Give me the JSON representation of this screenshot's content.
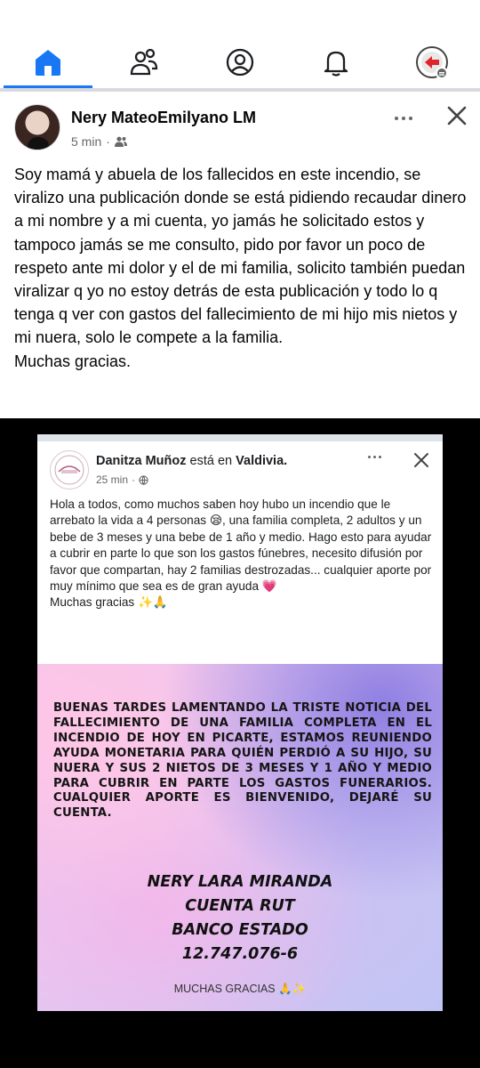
{
  "nav": {
    "items": [
      "home",
      "friends",
      "profile",
      "notifications",
      "menu"
    ],
    "active": "home",
    "accent_color": "#1877f2"
  },
  "post": {
    "author": "Nery MateoEmilyano LM",
    "time": "5 min",
    "audience_icon": "friends-icon",
    "text": "Soy mamá y abuela de los fallecidos en este incendio, se viralizo una publicación donde se está pidiendo recaudar dinero a mi nombre y a mi cuenta, yo jamás he solicitado estos y tampoco jamás se me consulto, pido por favor un poco de respeto  ante mi dolor y el de mi familia, solicito también puedan viralizar q yo no estoy detrás de esta publicación y todo lo q tenga q ver con gastos del fallecimiento de mi hijo mis nietos y mi nuera, solo le compete a la familia.\nMuchas gracias."
  },
  "shared": {
    "author": "Danitza Muñoz",
    "connector": "está en",
    "location": "Valdivia.",
    "time": "25 min",
    "audience_icon": "globe-icon",
    "text": "Hola a todos, como muchos saben hoy hubo un incendio que le arrebato la vida a 4 personas 😪, una familia completa, 2 adultos y un bebe de 3 meses y una bebe de 1 año y medio.  Hago esto para ayudar a cubrir en parte lo que son los gastos fúnebres, necesito difusión por favor que compartan, hay 2 familias destrozadas... cualquier aporte por muy mínimo que sea es de gran ayuda 💗\nMuchas gracias ✨🙏",
    "flyer": {
      "message": "BUENAS TARDES LAMENTANDO LA TRISTE NOTICIA DEL FALLECIMIENTO DE UNA FAMILIA COMPLETA EN EL INCENDIO DE HOY EN PICARTE, ESTAMOS REUNIENDO AYUDA MONETARIA PARA QUIÉN PERDIÓ A SU HIJO, SU NUERA Y SUS 2 NIETOS DE 3 MESES Y 1 AÑO Y MEDIO PARA CUBRIR EN PARTE LOS GASTOS FUNERARIOS. CUALQUIER APORTE ES BIENVENIDO, DEJARÉ SU CUENTA.",
      "name": "NERY LARA MIRANDA",
      "account_type": "CUENTA RUT",
      "bank": "BANCO ESTADO",
      "number": "12.747.076-6",
      "thanks": "MUCHAS GRACIAS 🙏✨"
    }
  }
}
